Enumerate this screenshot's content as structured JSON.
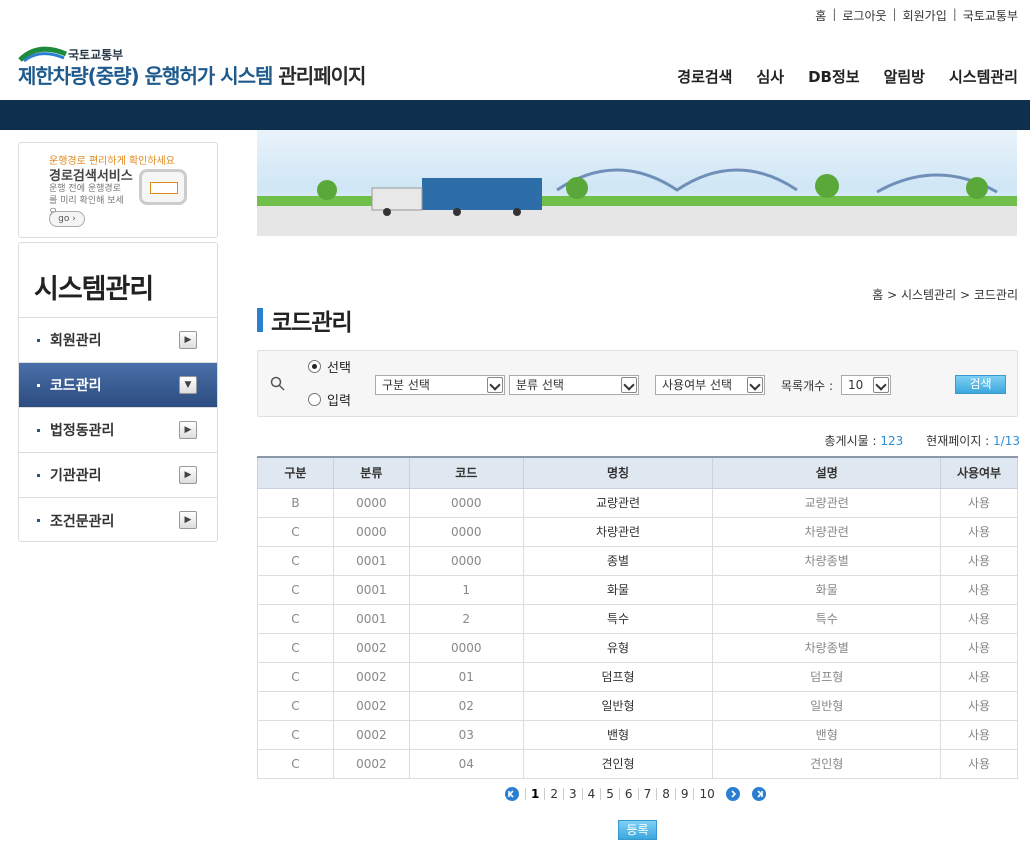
{
  "util_links": [
    "홈",
    "로그아웃",
    "회원가입",
    "국토교통부"
  ],
  "logo": {
    "ministry": "국토교통부",
    "title": "제한차량(중량) 운행허가 시스템",
    "admin": "관리페이지"
  },
  "gnb": [
    "경로검색",
    "심사",
    "DB정보",
    "알림방",
    "시스템관리"
  ],
  "promo": {
    "line1": "운행경로 편리하게 확인하세요",
    "line2": "경로검색서비스",
    "line3": "운행 전에 운행경로를 미리 확인해 보세요.",
    "go": "go"
  },
  "sidebar": {
    "title": "시스템관리",
    "items": [
      {
        "label": "회원관리"
      },
      {
        "label": "코드관리"
      },
      {
        "label": "법정동관리"
      },
      {
        "label": "기관관리"
      },
      {
        "label": "조건문관리"
      }
    ]
  },
  "breadcrumb": {
    "home": "홈",
    "level1": "시스템관리",
    "level2": "코드관리"
  },
  "page_title": "코드관리",
  "search": {
    "radio_select": "선택",
    "radio_input": "입력",
    "select_gubun": "구분 선택",
    "select_bunryu": "분류 선택",
    "select_use": "사용여부 선택",
    "list_count_label": "목록개수 :",
    "list_count_value": "10",
    "search_button": "검색"
  },
  "stats": {
    "total_label": "총게시물 :",
    "total_value": "123",
    "page_label": "현재페이지 :",
    "page_value": "1/13"
  },
  "table": {
    "headers": [
      "구분",
      "분류",
      "코드",
      "명칭",
      "설명",
      "사용여부"
    ],
    "rows": [
      [
        "B",
        "0000",
        "0000",
        "교량관련",
        "교량관련",
        "사용"
      ],
      [
        "C",
        "0000",
        "0000",
        "차량관련",
        "차량관련",
        "사용"
      ],
      [
        "C",
        "0001",
        "0000",
        "종별",
        "차량종별",
        "사용"
      ],
      [
        "C",
        "0001",
        "1",
        "화물",
        "화물",
        "사용"
      ],
      [
        "C",
        "0001",
        "2",
        "특수",
        "특수",
        "사용"
      ],
      [
        "C",
        "0002",
        "0000",
        "유형",
        "차량종별",
        "사용"
      ],
      [
        "C",
        "0002",
        "01",
        "덤프형",
        "덤프형",
        "사용"
      ],
      [
        "C",
        "0002",
        "02",
        "일반형",
        "일반형",
        "사용"
      ],
      [
        "C",
        "0002",
        "03",
        "밴형",
        "밴형",
        "사용"
      ],
      [
        "C",
        "0002",
        "04",
        "견인형",
        "견인형",
        "사용"
      ]
    ]
  },
  "pagination": [
    "1",
    "2",
    "3",
    "4",
    "5",
    "6",
    "7",
    "8",
    "9",
    "10"
  ],
  "register_button": "등록",
  "colors": {
    "navbar": "#0f2f4f",
    "accent": "#2a7fd0",
    "active_menu": "#2b4c80"
  }
}
